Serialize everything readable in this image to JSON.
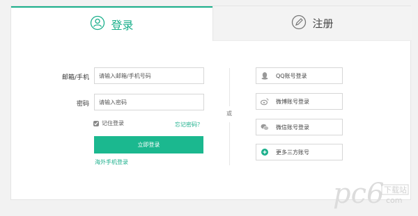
{
  "tabs": {
    "login": {
      "label": "登录",
      "icon": "user-circle-icon",
      "active": true
    },
    "register": {
      "label": "注册",
      "icon": "pencil-circle-icon",
      "active": false
    }
  },
  "form": {
    "email_label": "邮箱/手机",
    "email_placeholder": "请输入邮箱/手机号码",
    "password_label": "密码",
    "password_placeholder": "请输入密码",
    "remember_label": "记住登录",
    "remember_checked": true,
    "forgot_link": "忘记密码？",
    "login_button": "立即登录",
    "overseas_link": "海外手机登录"
  },
  "separator": "或",
  "social": [
    {
      "label": "QQ账号登录",
      "icon": "qq-icon"
    },
    {
      "label": "微博账号登录",
      "icon": "weibo-icon"
    },
    {
      "label": "微信账号登录",
      "icon": "wechat-icon"
    },
    {
      "label": "更多三方账号",
      "icon": "plus-circle-icon"
    }
  ],
  "watermark": {
    "logo": "pc6",
    "sub": "下载站",
    "url": "com"
  },
  "colors": {
    "accent": "#1aaf8b",
    "button": "#1bb88f",
    "tab_inactive_bg": "#f3f3f3"
  }
}
